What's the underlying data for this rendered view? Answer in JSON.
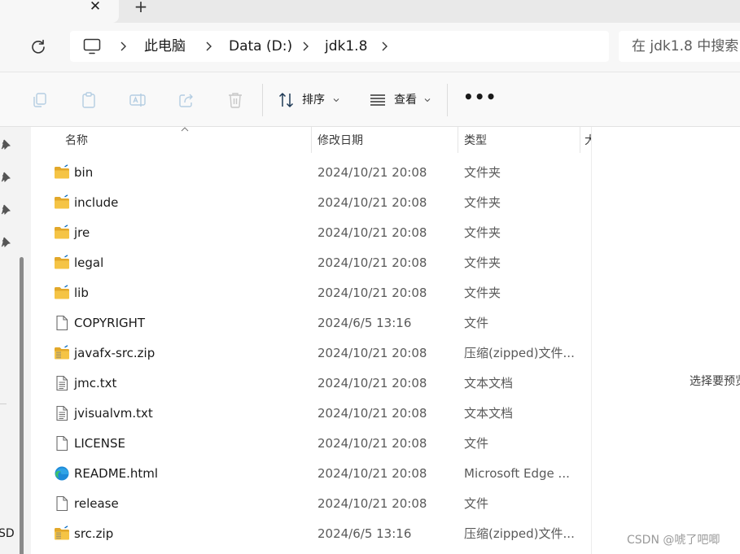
{
  "tabbar": {
    "close_glyph": "✕",
    "new_tab_glyph": "+"
  },
  "address": {
    "crumbs": [
      "此电脑",
      "Data (D:)",
      "jdk1.8"
    ],
    "search_placeholder": "在 jdk1.8 中搜索"
  },
  "commands": {
    "sort_label": "排序",
    "view_label": "查看",
    "more_label": "•••"
  },
  "nav": {
    "partial_text": "SD"
  },
  "columns": {
    "name": "名称",
    "date": "修改日期",
    "type": "类型",
    "size_partial": "大"
  },
  "files": [
    {
      "name": "bin",
      "date": "2024/10/21 20:08",
      "type": "文件夹",
      "icon": "folder-icon"
    },
    {
      "name": "include",
      "date": "2024/10/21 20:08",
      "type": "文件夹",
      "icon": "folder-icon"
    },
    {
      "name": "jre",
      "date": "2024/10/21 20:08",
      "type": "文件夹",
      "icon": "folder-icon"
    },
    {
      "name": "legal",
      "date": "2024/10/21 20:08",
      "type": "文件夹",
      "icon": "folder-icon"
    },
    {
      "name": "lib",
      "date": "2024/10/21 20:08",
      "type": "文件夹",
      "icon": "folder-icon"
    },
    {
      "name": "COPYRIGHT",
      "date": "2024/6/5 13:16",
      "type": "文件",
      "icon": "file-icon"
    },
    {
      "name": "javafx-src.zip",
      "date": "2024/10/21 20:08",
      "type": "压缩(zipped)文件...",
      "icon": "zip-icon"
    },
    {
      "name": "jmc.txt",
      "date": "2024/10/21 20:08",
      "type": "文本文档",
      "icon": "text-file-icon"
    },
    {
      "name": "jvisualvm.txt",
      "date": "2024/10/21 20:08",
      "type": "文本文档",
      "icon": "text-file-icon"
    },
    {
      "name": "LICENSE",
      "date": "2024/10/21 20:08",
      "type": "文件",
      "icon": "file-icon"
    },
    {
      "name": "README.html",
      "date": "2024/10/21 20:08",
      "type": "Microsoft Edge ...",
      "icon": "edge-icon"
    },
    {
      "name": "release",
      "date": "2024/10/21 20:08",
      "type": "文件",
      "icon": "file-icon"
    },
    {
      "name": "src.zip",
      "date": "2024/6/5 13:16",
      "type": "压缩(zipped)文件...",
      "icon": "zip-icon"
    }
  ],
  "preview": {
    "message": "选择要预览",
    "watermark": "CSDN @唬了吧唧"
  },
  "colors": {
    "folder": "#f5c445",
    "folder_dark": "#e2a82a",
    "accent": "#0067c0",
    "edge_blue": "#1d8ad8",
    "edge_green": "#3cc26b"
  }
}
